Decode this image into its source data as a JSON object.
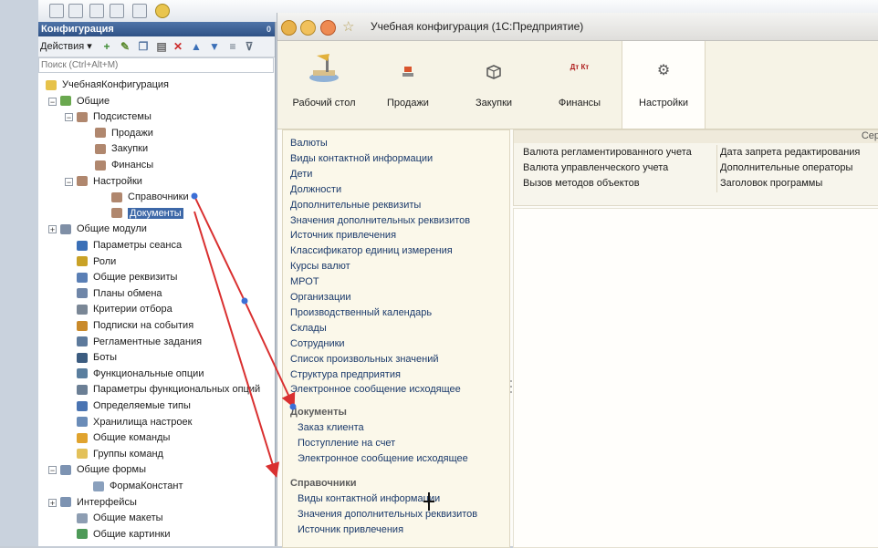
{
  "config": {
    "title": "Конфигурация",
    "close_glyph": "0",
    "actions_label": "Действия ▾",
    "search_placeholder": "Поиск (Ctrl+Alt+M)",
    "tree": [
      {
        "label": "УчебнаяКонфигурация",
        "icon": "config-root-icon",
        "color": "#e6c24a"
      },
      {
        "label": "Общие",
        "icon": "common-icon",
        "color": "#6aa84f"
      },
      {
        "label": "Подсистемы",
        "icon": "subsystems-icon",
        "color": "#b0876e"
      },
      {
        "label": "Продажи",
        "icon": "subsystem-icon",
        "color": "#b0876e"
      },
      {
        "label": "Закупки",
        "icon": "subsystem-icon",
        "color": "#b0876e"
      },
      {
        "label": "Финансы",
        "icon": "subsystem-icon",
        "color": "#b0876e"
      },
      {
        "label": "Настройки",
        "icon": "subsystem-icon",
        "color": "#b0876e"
      },
      {
        "label": "Справочники",
        "icon": "subsystem-icon",
        "color": "#b0876e"
      },
      {
        "label": "Документы",
        "icon": "subsystem-icon",
        "color": "#b0876e"
      },
      {
        "label": "Общие модули",
        "icon": "modules-icon",
        "color": "#7f8fa6"
      },
      {
        "label": "Параметры сеанса",
        "icon": "session-params-icon",
        "color": "#3a6fb7"
      },
      {
        "label": "Роли",
        "icon": "roles-icon",
        "color": "#c9a227"
      },
      {
        "label": "Общие реквизиты",
        "icon": "common-attributes-icon",
        "color": "#5a7fb5"
      },
      {
        "label": "Планы обмена",
        "icon": "exchange-plans-icon",
        "color": "#6f86a8"
      },
      {
        "label": "Критерии отбора",
        "icon": "filter-criteria-icon",
        "color": "#7a8796"
      },
      {
        "label": "Подписки на события",
        "icon": "event-subscriptions-icon",
        "color": "#c98a2b"
      },
      {
        "label": "Регламентные задания",
        "icon": "scheduled-jobs-icon",
        "color": "#5d7a9c"
      },
      {
        "label": "Боты",
        "icon": "bots-icon",
        "color": "#3c5c80"
      },
      {
        "label": "Функциональные опции",
        "icon": "functional-options-icon",
        "color": "#5a7e9e"
      },
      {
        "label": "Параметры функциональных опций",
        "icon": "fo-params-icon",
        "color": "#6b7f95"
      },
      {
        "label": "Определяемые типы",
        "icon": "defined-types-icon",
        "color": "#4a74b2"
      },
      {
        "label": "Хранилища настроек",
        "icon": "settings-storage-icon",
        "color": "#6a8cb8"
      },
      {
        "label": "Общие команды",
        "icon": "common-commands-icon",
        "color": "#e0a32e"
      },
      {
        "label": "Группы команд",
        "icon": "command-groups-icon",
        "color": "#e3c15a"
      },
      {
        "label": "Общие формы",
        "icon": "common-forms-icon",
        "color": "#7d93b2"
      },
      {
        "label": "ФормаКонстант",
        "icon": "form-icon",
        "color": "#8aa0bd"
      },
      {
        "label": "Интерфейсы",
        "icon": "interfaces-icon",
        "color": "#7d93b2"
      },
      {
        "label": "Общие макеты",
        "icon": "layouts-icon",
        "color": "#8d9db2"
      },
      {
        "label": "Общие картинки",
        "icon": "pictures-icon",
        "color": "#4e9a58"
      }
    ]
  },
  "app": {
    "title": "Учебная конфигурация (1С:Предприятие)",
    "sections": [
      {
        "label": "Рабочий стол"
      },
      {
        "label": "Продажи"
      },
      {
        "label": "Закупки"
      },
      {
        "label": "Финансы"
      },
      {
        "label": "Настройки"
      }
    ],
    "finance_icon_text": "Дт Кт",
    "nav_links": [
      "Валюты",
      "Виды контактной информации",
      "Дети",
      "Должности",
      "Дополнительные реквизиты",
      "Значения дополнительных реквизитов",
      "Источник привлечения",
      "Классификатор единиц измерения",
      "Курсы валют",
      "МРОТ",
      "Организации",
      "Производственный календарь",
      "Склады",
      "Сотрудники",
      "Список произвольных значений",
      "Структура предприятия",
      "Электронное сообщение исходящее"
    ],
    "docs_header": "Документы",
    "docs_links": [
      "Заказ клиента",
      "Поступление на счет",
      "Электронное сообщение исходящее"
    ],
    "refs_header": "Справочники",
    "refs_links": [
      "Виды контактной информации",
      "Значения дополнительных реквизитов",
      "Источник привлечения"
    ],
    "panel_header": "Сер",
    "panel_col1": [
      "Валюта регламентированного учета",
      "Валюта управленческого учета",
      "Вызов методов объектов"
    ],
    "panel_col2": [
      "Дата запрета редактирования",
      "Дополнительные операторы",
      "Заголовок программы"
    ]
  }
}
